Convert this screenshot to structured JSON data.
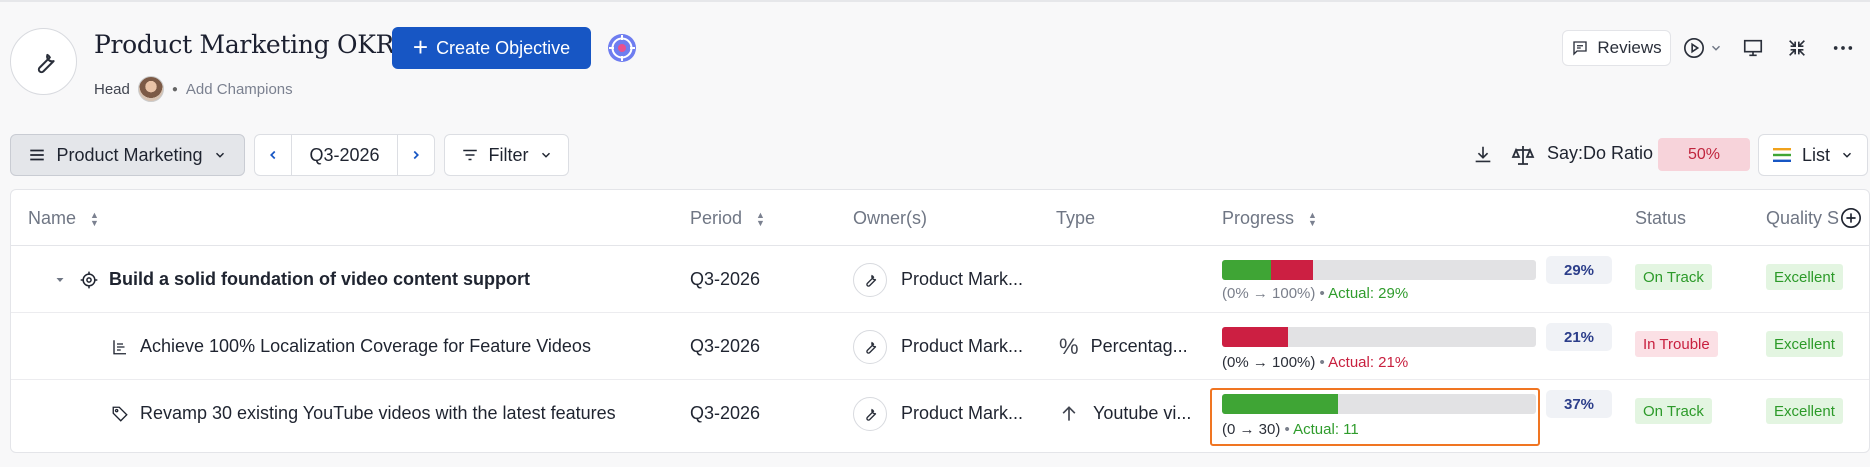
{
  "header": {
    "title": "Product Marketing OKRs",
    "create_label": "Create Objective",
    "head_label": "Head",
    "champions_label": "Add Champions",
    "reviews_label": "Reviews"
  },
  "toolbar": {
    "team_label": "Product Marketing",
    "period_label": "Q3-2026",
    "filter_label": "Filter",
    "saydo_label": "Say:Do Ratio",
    "saydo_value": "50%",
    "view_label": "List"
  },
  "table": {
    "columns": {
      "name": "Name",
      "period": "Period",
      "owners": "Owner(s)",
      "type": "Type",
      "progress": "Progress",
      "status": "Status",
      "quality": "Quality S"
    },
    "rows": [
      {
        "name": "Build a solid foundation of video content support",
        "period": "Q3-2026",
        "owner": "Product Mark...",
        "type": "",
        "progress_range": "(0% → 100%)",
        "progress_actual": "Actual: 29%",
        "progress_pct": "29%",
        "progress_fraction": 0.29,
        "status": "On Track",
        "quality": "Excellent"
      },
      {
        "name": "Achieve 100% Localization Coverage for Feature Videos",
        "period": "Q3-2026",
        "owner": "Product Mark...",
        "type": "Percentag...",
        "progress_range": "(0%  →  100%)",
        "progress_actual": "Actual: 21%",
        "progress_pct": "21%",
        "progress_fraction": 0.21,
        "status": "In Trouble",
        "quality": "Excellent"
      },
      {
        "name": "Revamp 30 existing YouTube videos with the latest features",
        "period": "Q3-2026",
        "owner": "Product Mark...",
        "type": "Youtube vi...",
        "progress_range": "(0  →  30)",
        "progress_actual": "Actual: 11",
        "progress_pct": "37%",
        "progress_fraction": 0.37,
        "status": "On Track",
        "quality": "Excellent"
      }
    ]
  },
  "colors": {
    "primary": "#1756c4",
    "progress_green": "#3fa535",
    "progress_red": "#cc1f42",
    "highlight": "#f07522"
  }
}
